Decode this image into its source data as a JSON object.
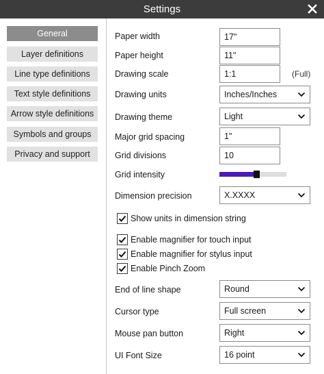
{
  "window": {
    "title": "Settings",
    "close_icon": "close-icon"
  },
  "sidebar": {
    "items": [
      {
        "label": "General",
        "active": true
      },
      {
        "label": "Layer definitions",
        "active": false
      },
      {
        "label": "Line type definitions",
        "active": false
      },
      {
        "label": "Text style definitions",
        "active": false
      },
      {
        "label": "Arrow style definitions",
        "active": false
      },
      {
        "label": "Symbols and groups",
        "active": false
      },
      {
        "label": "Privacy and support",
        "active": false
      }
    ]
  },
  "settings": {
    "paper_width": {
      "label": "Paper width",
      "value": "17\""
    },
    "paper_height": {
      "label": "Paper height",
      "value": "11\""
    },
    "drawing_scale": {
      "label": "Drawing scale",
      "value": "1:1",
      "suffix": "(Full)"
    },
    "drawing_units": {
      "label": "Drawing units",
      "value": "Inches/Inches"
    },
    "drawing_theme": {
      "label": "Drawing theme",
      "value": "Light"
    },
    "major_grid_spacing": {
      "label": "Major grid spacing",
      "value": "1\""
    },
    "grid_divisions": {
      "label": "Grid divisions",
      "value": "10"
    },
    "grid_intensity": {
      "label": "Grid intensity",
      "level": 0.56
    },
    "dimension_precision": {
      "label": "Dimension precision",
      "value": "X.XXXX"
    },
    "show_units": {
      "label": "Show units in dimension string",
      "checked": true
    },
    "magnifier_touch": {
      "label": "Enable magnifier for touch input",
      "checked": true
    },
    "magnifier_stylus": {
      "label": "Enable magnifier for stylus input",
      "checked": true
    },
    "pinch_zoom": {
      "label": "Enable Pinch Zoom",
      "checked": true
    },
    "end_of_line_shape": {
      "label": "End of line shape",
      "value": "Round"
    },
    "cursor_type": {
      "label": "Cursor type",
      "value": "Full screen"
    },
    "mouse_pan_button": {
      "label": "Mouse pan button",
      "value": "Right"
    },
    "ui_font_size": {
      "label": "UI Font Size",
      "value": "16 point"
    }
  },
  "colors": {
    "titlebar": "#3c3c3c",
    "slider_fill": "#4a1ab8",
    "nav_active": "#8c8c8c",
    "nav_inactive": "#e1e1e1"
  }
}
